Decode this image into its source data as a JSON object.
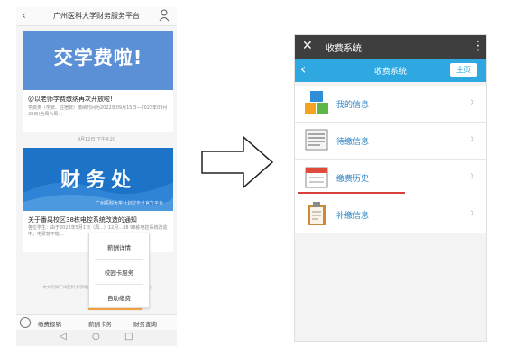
{
  "left_phone": {
    "title": "广州医科大学财务服务平台",
    "back_icon": "chevron-left-icon",
    "banner1": "交学费啦!",
    "news1": {
      "headline": "@以老师学费缴纳再次开放啦!",
      "summary": "学费类（学费、住宿费）缴纳时间为2022年09月15日—2022年09月28日(含周六周..."
    },
    "timestamp": "9月12日 下午4:20",
    "banner2": "财务处",
    "banner2_tag": "广州医科大学计划财务处官方平台",
    "news2": {
      "headline": "关于番禺校区38栋电控系统改造的通知",
      "summary": "各位学生：由于2022年5月1日（周...）12月…38 98栋电控系统改造中，电费暂不能…"
    },
    "popup_items": [
      "薪酬详情",
      "校园卡服务",
      "自助缴费"
    ],
    "footer_text": "本文仅供广州医科大学财务服务平台使用，其它用途禁止转载",
    "tabs": [
      "缴费报销",
      "薪酬卡务",
      "财务查询"
    ],
    "nav": [
      "◁",
      "○",
      "□"
    ]
  },
  "arrow_icon": "right-arrow-icon",
  "right_phone": {
    "app_title": "收费系统",
    "header_title": "收费系统",
    "home_button": "主页",
    "rows": [
      {
        "label": "我的信息",
        "icon": "blocks-icon"
      },
      {
        "label": "待缴信息",
        "icon": "document-icon"
      },
      {
        "label": "缴费历史",
        "icon": "calendar-icon"
      },
      {
        "label": "补缴信息",
        "icon": "clipboard-icon"
      }
    ]
  },
  "colors": {
    "accent_blue": "#2fa8e1",
    "dark_bar": "#3e3e3e",
    "highlight_red": "#d9403a",
    "banner_blue": "#5b8fd6"
  }
}
